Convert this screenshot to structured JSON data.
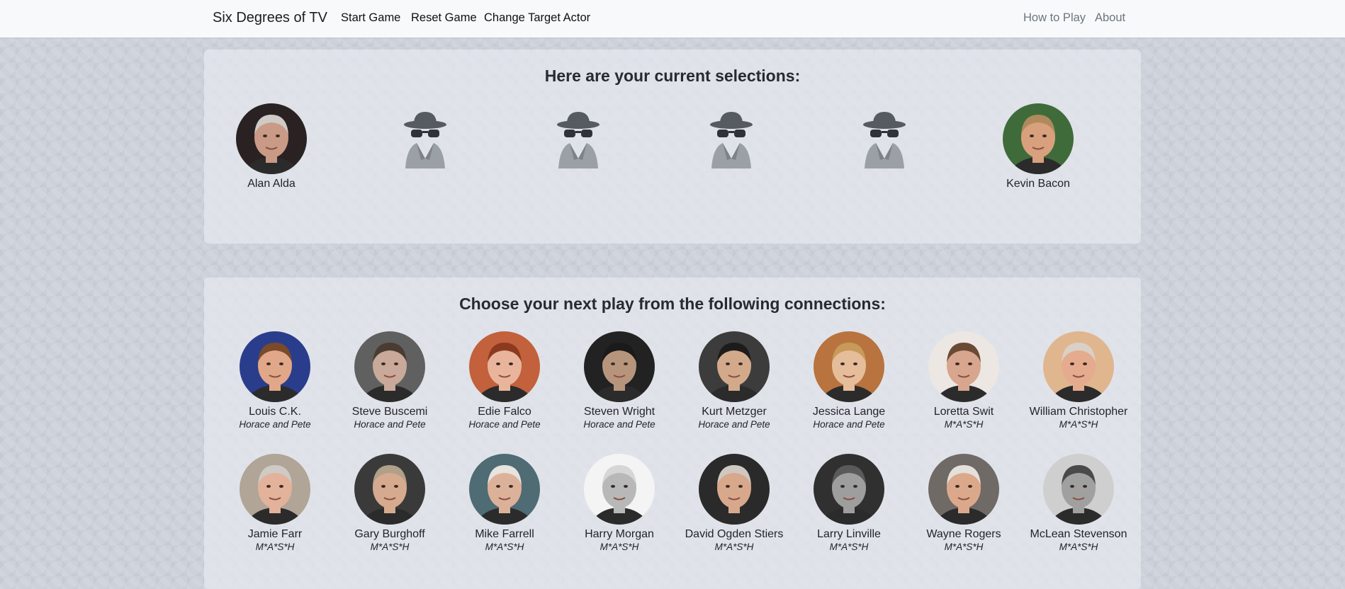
{
  "navbar": {
    "brand": "Six Degrees of TV",
    "links_left": [
      "Start Game",
      "Reset Game",
      "Change Target Actor"
    ],
    "links_right": [
      "How to Play",
      "About"
    ]
  },
  "selections": {
    "title": "Here are your current selections:",
    "start": {
      "name": "Alan Alda",
      "skin": "#c99a86",
      "bg": "#2a2222",
      "hair": "#cfcac5"
    },
    "target": {
      "name": "Kevin Bacon",
      "skin": "#d9a07e",
      "bg": "#3f6b3a",
      "hair": "#b08a5c"
    }
  },
  "connections": {
    "title": "Choose your next play from the following connections:",
    "row1": [
      {
        "name": "Louis C.K.",
        "show": "Horace and Pete",
        "bg": "#2a3d8c",
        "skin": "#e1a789",
        "hair": "#7a4a2a"
      },
      {
        "name": "Steve Buscemi",
        "show": "Horace and Pete",
        "bg": "#606060",
        "skin": "#c8a99a",
        "hair": "#4a3c33"
      },
      {
        "name": "Edie Falco",
        "show": "Horace and Pete",
        "bg": "#c2613b",
        "skin": "#e8b59c",
        "hair": "#8c3a1f"
      },
      {
        "name": "Steven Wright",
        "show": "Horace and Pete",
        "bg": "#222222",
        "skin": "#b7957d",
        "hair": "#1a1a1a"
      },
      {
        "name": "Kurt Metzger",
        "show": "Horace and Pete",
        "bg": "#3c3c3c",
        "skin": "#d3a98c",
        "hair": "#1c1c1c"
      },
      {
        "name": "Jessica Lange",
        "show": "Horace and Pete",
        "bg": "#b8733e",
        "skin": "#e6bd9a",
        "hair": "#c89a5a"
      },
      {
        "name": "Loretta Swit",
        "show": "M*A*S*H",
        "bg": "#ece7e2",
        "skin": "#d8a58f",
        "hair": "#6b4a35"
      },
      {
        "name": "William Christopher",
        "show": "M*A*S*H",
        "bg": "#e0b68e",
        "skin": "#e5ab8e",
        "hair": "#d9d0c8"
      }
    ],
    "row2": [
      {
        "name": "Jamie Farr",
        "show": "M*A*S*H",
        "bg": "#b0a596",
        "skin": "#e2b29b",
        "hair": "#cfcac5"
      },
      {
        "name": "Gary Burghoff",
        "show": "M*A*S*H",
        "bg": "#3a3a3a",
        "skin": "#d6aa8f",
        "hair": "#b0a08a"
      },
      {
        "name": "Mike Farrell",
        "show": "M*A*S*H",
        "bg": "#4f6b74",
        "skin": "#dcb19a",
        "hair": "#e7e3df"
      },
      {
        "name": "Harry Morgan",
        "show": "M*A*S*H",
        "bg": "#f4f4f4",
        "skin": "#b8b8b8",
        "hair": "#d6d6d6"
      },
      {
        "name": "David Ogden Stiers",
        "show": "M*A*S*H",
        "bg": "#2a2a2a",
        "skin": "#d8a88c",
        "hair": "#cfc8c0"
      },
      {
        "name": "Larry Linville",
        "show": "M*A*S*H",
        "bg": "#303030",
        "skin": "#9e9e9e",
        "hair": "#5a5a5a"
      },
      {
        "name": "Wayne Rogers",
        "show": "M*A*S*H",
        "bg": "#6f6a66",
        "skin": "#dca88c",
        "hair": "#e4e0db"
      },
      {
        "name": "McLean Stevenson",
        "show": "M*A*S*H",
        "bg": "#cfcfcf",
        "skin": "#a0a0a0",
        "hair": "#4a4a4a"
      }
    ]
  }
}
